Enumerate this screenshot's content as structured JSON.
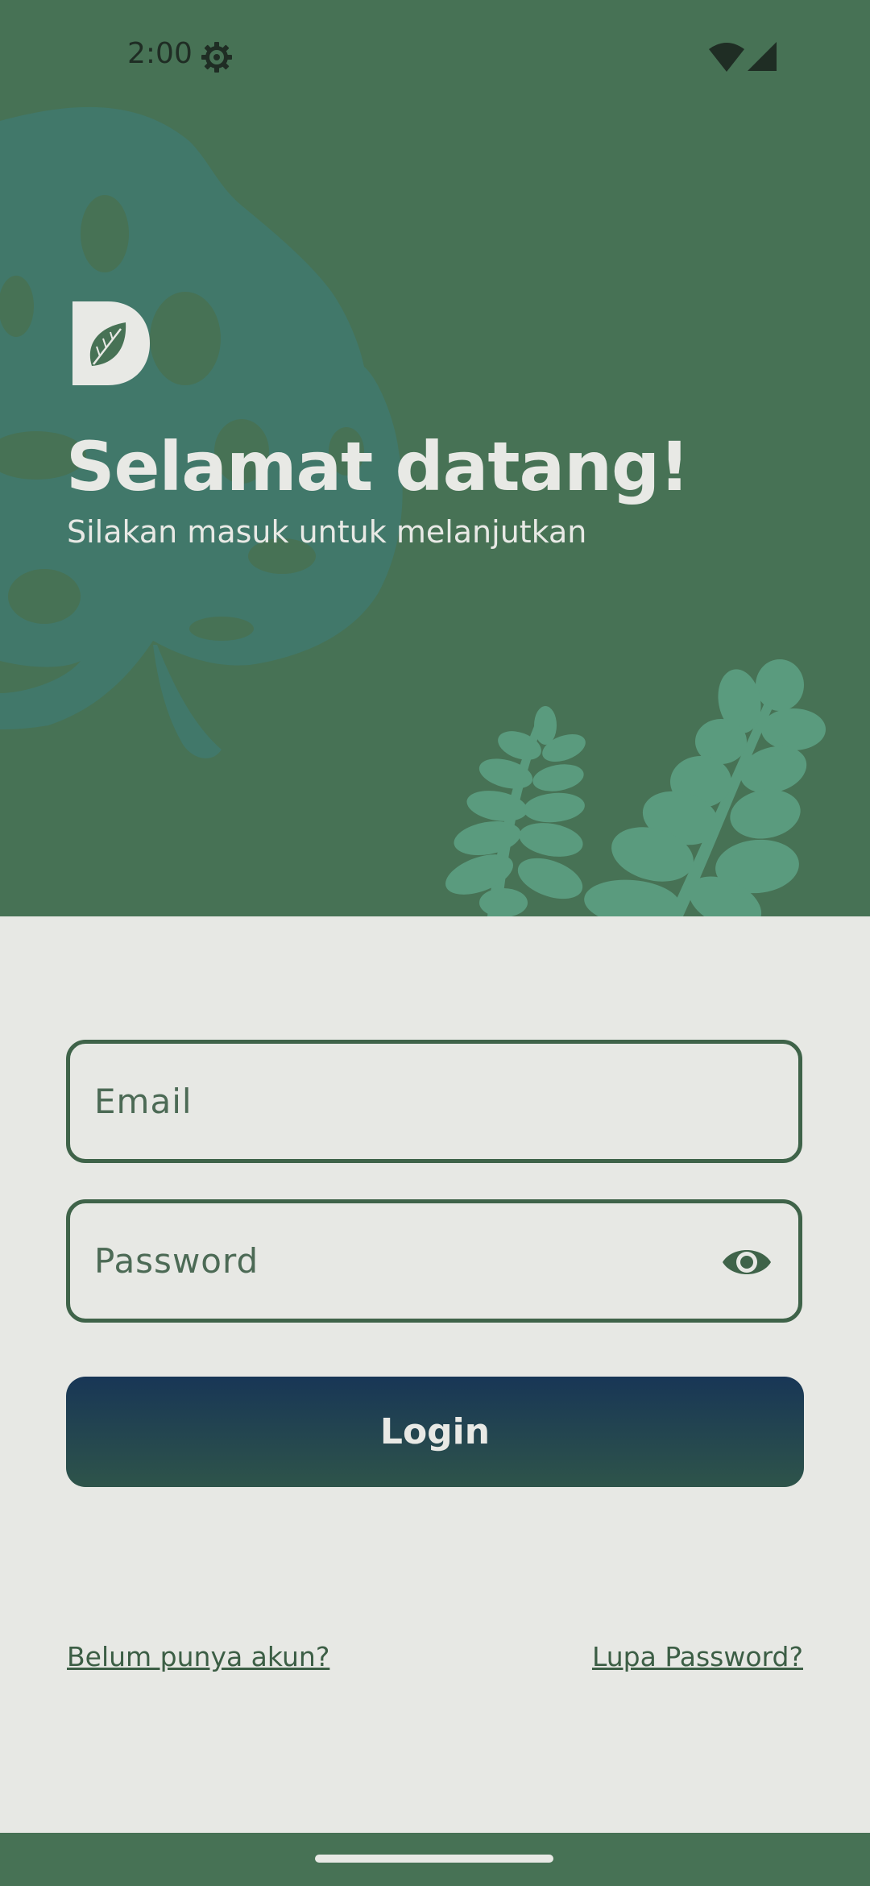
{
  "status_bar": {
    "time": "2:00",
    "icons": [
      "settings-gear-icon",
      "wifi-icon",
      "cellular-signal-icon"
    ]
  },
  "hero": {
    "logo_icon": "leaf-d-logo-icon",
    "title": "Selamat datang!",
    "subtitle": "Silakan masuk untuk melanjutkan"
  },
  "form": {
    "email_placeholder": "Email",
    "email_value": "",
    "password_placeholder": "Password",
    "password_value": "",
    "password_toggle_icon": "eye-icon",
    "login_label": "Login"
  },
  "links": {
    "register": "Belum punya akun?",
    "forgot_password": "Lupa Password?"
  },
  "colors": {
    "hero_background": "#477255",
    "foliage_light": "#5a9b7e",
    "foliage_dark": "#41786a",
    "page_background": "#e7e8e4",
    "accent": "#3f6349",
    "button_gradient_top": "#183656",
    "button_gradient_bottom": "#2e544a"
  }
}
